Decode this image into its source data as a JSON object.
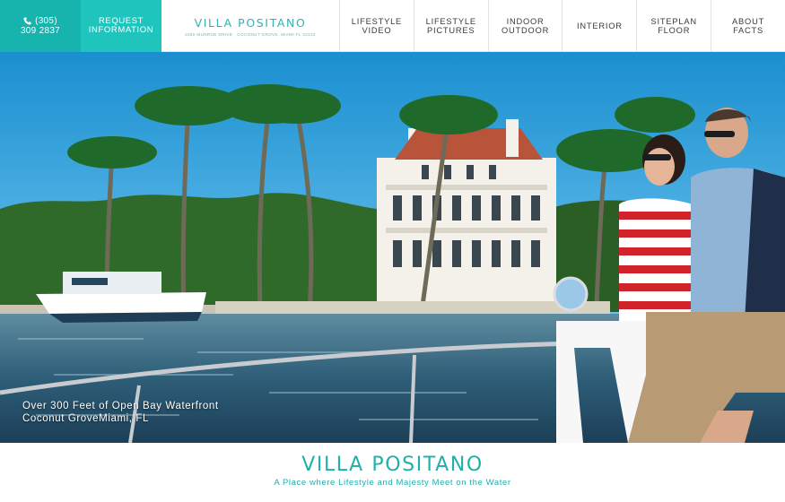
{
  "header": {
    "phone_line1": "(305)",
    "phone_line2": "309 2837",
    "request_line1": "REQUEST",
    "request_line2": "INFORMATION",
    "logo_title": "VILLA POSITANO",
    "logo_subtitle": "3360 MUNROE DRIVE · COCONUT GROVE, MIAMI FL 33133"
  },
  "nav": {
    "items": [
      {
        "line1": "LIFESTYLE",
        "line2": "VIDEO"
      },
      {
        "line1": "LIFESTYLE",
        "line2": "PICTURES"
      },
      {
        "line1": "INDOOR",
        "line2": "OUTDOOR"
      },
      {
        "line1": "INTERIOR",
        "line2": ""
      },
      {
        "line1": "SITEPLAN",
        "line2": "FLOOR"
      },
      {
        "line1": "ABOUT",
        "line2": "FACTS"
      }
    ]
  },
  "hero": {
    "caption_line1": "Over 300 Feet of Open Bay Waterfront",
    "caption_line2": "Coconut GroveMiami, FL"
  },
  "footer_title": {
    "title": "VILLA POSITANO",
    "subtitle": "A Place where Lifestyle and Majesty Meet on the Water"
  },
  "colors": {
    "accent_dark": "#17b3ad",
    "accent": "#1fc4bc",
    "title_teal": "#1fb0aa"
  },
  "icons": {
    "phone": "phone-icon"
  }
}
